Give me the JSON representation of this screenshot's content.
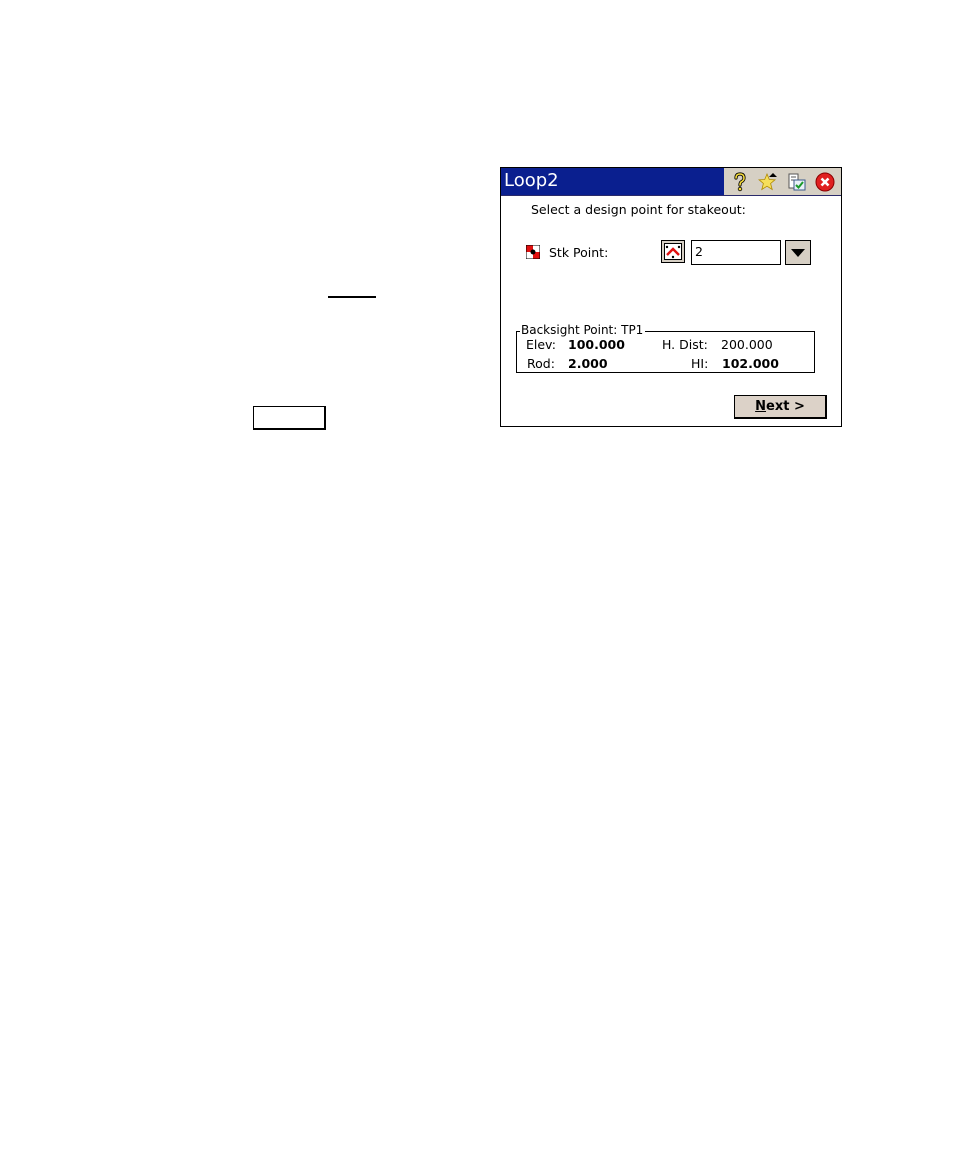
{
  "window": {
    "title": "Loop2",
    "title_icons": [
      "help-icon",
      "favorites-star-icon",
      "switch-window-icon",
      "close-icon"
    ]
  },
  "prompt": "Select a design point for stakeout:",
  "stake_point": {
    "label": "Stk Point:",
    "value": "2",
    "icon": "point-type-icon",
    "map_button_icon": "map-select-icon",
    "dropdown_icon": "dropdown-arrow-icon"
  },
  "backsight": {
    "legend": "Backsight Point: TP1",
    "elev_label": "Elev:",
    "elev_value": "100.000",
    "hdist_label": "H. Dist:",
    "hdist_value": "200.000",
    "rod_label": "Rod:",
    "rod_value": "2.000",
    "hi_label": "HI:",
    "hi_value": "102.000"
  },
  "buttons": {
    "next_mnemonic": "N",
    "next_rest": "ext >"
  },
  "colors": {
    "titlebar": "#0a1f8f",
    "button_face": "#d6cfc4"
  }
}
